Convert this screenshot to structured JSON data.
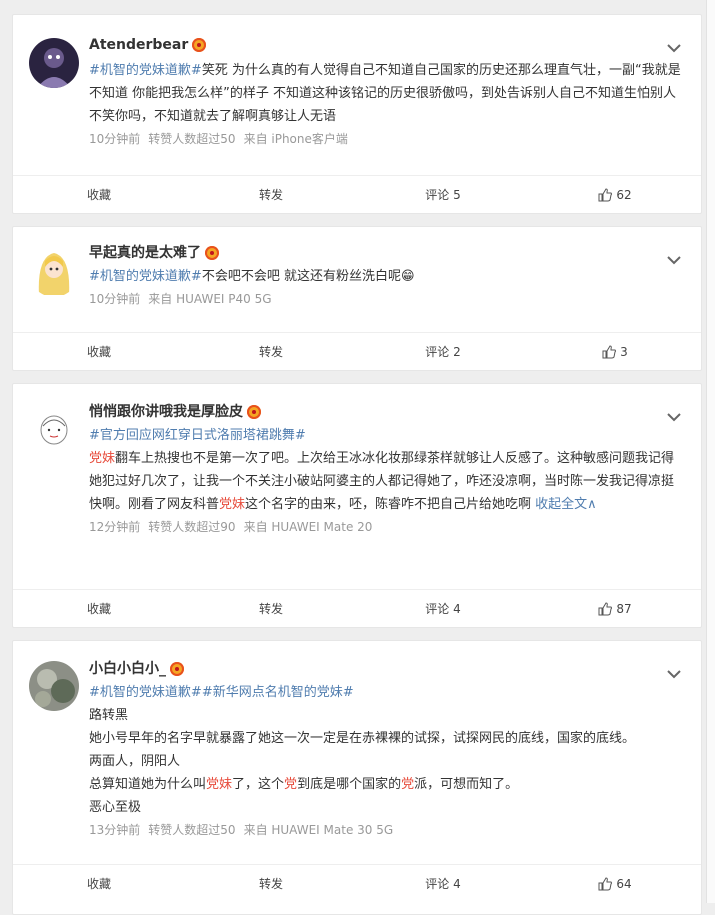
{
  "posts": [
    {
      "username": "Atenderbear",
      "segments": [
        {
          "t": "#机智的",
          "c": "tag"
        },
        {
          "t": "党妹",
          "c": "hl"
        },
        {
          "t": "道歉#",
          "c": "tag"
        },
        {
          "t": "笑死 为什么真的有人觉得自己不知道自己国家的历史还那么理直气壮，一副“我就是不知道 你能把我怎么样”的样子 不知道这种该铭记的历史很骄傲吗，到处告诉别人自己不知道生怕别人不笑你吗，不知道就去了解啊真够让人无语",
          "c": ""
        }
      ],
      "meta": [
        "10分钟前",
        "转赞人数超过50",
        "来自 iPhone客户端"
      ],
      "actions": {
        "fav": "收藏",
        "repost": "转发",
        "comment": "评论 5",
        "like": "62"
      }
    },
    {
      "username": "早起真的是太难了",
      "segments": [
        {
          "t": "#机智的",
          "c": "tag"
        },
        {
          "t": "党妹",
          "c": "hl"
        },
        {
          "t": "道歉#",
          "c": "tag"
        },
        {
          "t": "不会吧不会吧 就这还有粉丝洗白呢😁",
          "c": ""
        }
      ],
      "meta": [
        "10分钟前",
        "来自 HUAWEI P40 5G"
      ],
      "actions": {
        "fav": "收藏",
        "repost": "转发",
        "comment": "评论 2",
        "like": "3"
      }
    },
    {
      "username": "悄悄跟你讲哦我是厚脸皮",
      "segments": [
        {
          "t": "#官方回应网红穿日式洛丽塔裙跳舞#",
          "c": "tag",
          "br": true
        },
        {
          "t": "党妹",
          "c": "hl"
        },
        {
          "t": "翻车上热搜也不是第一次了吧。上次给王冰冰化妆那绿茶样就够让人反感了。这种敏感问题我记得她犯过好几次了，让我一个不关注小破站阿婆主的人都记得她了，咋还没凉啊，当时陈一发我记得凉挺快啊。刚看了网友科普",
          "c": ""
        },
        {
          "t": "党妹",
          "c": "hl"
        },
        {
          "t": "这个名字的由来，呸，陈睿咋不把自己片给她吃啊 ",
          "c": ""
        },
        {
          "t": "收起全文∧",
          "c": "link"
        }
      ],
      "meta": [
        "12分钟前",
        "转赞人数超过90",
        "来自 HUAWEI Mate 20"
      ],
      "actions": {
        "fav": "收藏",
        "repost": "转发",
        "comment": "评论 4",
        "like": "87"
      }
    },
    {
      "username": "小白小白小_",
      "segments": [
        {
          "t": "#机智的",
          "c": "tag"
        },
        {
          "t": "党妹",
          "c": "hl"
        },
        {
          "t": "道歉##新华网点名机智的",
          "c": "tag"
        },
        {
          "t": "党妹",
          "c": "hl"
        },
        {
          "t": "#",
          "c": "tag",
          "br": true
        },
        {
          "t": "路转黑",
          "c": "",
          "br": true
        },
        {
          "t": "她小号早年的名字早就暴露了她这一次一定是在赤裸裸的试探，试探网民的底线，国家的底线。",
          "c": "",
          "br": true
        },
        {
          "t": "两面人，阴阳人",
          "c": "",
          "br": true
        },
        {
          "t": "总算知道她为什么叫",
          "c": ""
        },
        {
          "t": "党妹",
          "c": "hl"
        },
        {
          "t": "了，这个",
          "c": ""
        },
        {
          "t": "党",
          "c": "hl"
        },
        {
          "t": "到底是哪个国家的",
          "c": ""
        },
        {
          "t": "党",
          "c": "hl"
        },
        {
          "t": "派，可想而知了。",
          "c": "",
          "br": true
        },
        {
          "t": "恶心至极",
          "c": ""
        }
      ],
      "meta": [
        "13分钟前",
        "转赞人数超过50",
        "来自 HUAWEI Mate 30 5G"
      ],
      "actions": {
        "fav": "收藏",
        "repost": "转发",
        "comment": "评论 4",
        "like": "64"
      }
    }
  ]
}
